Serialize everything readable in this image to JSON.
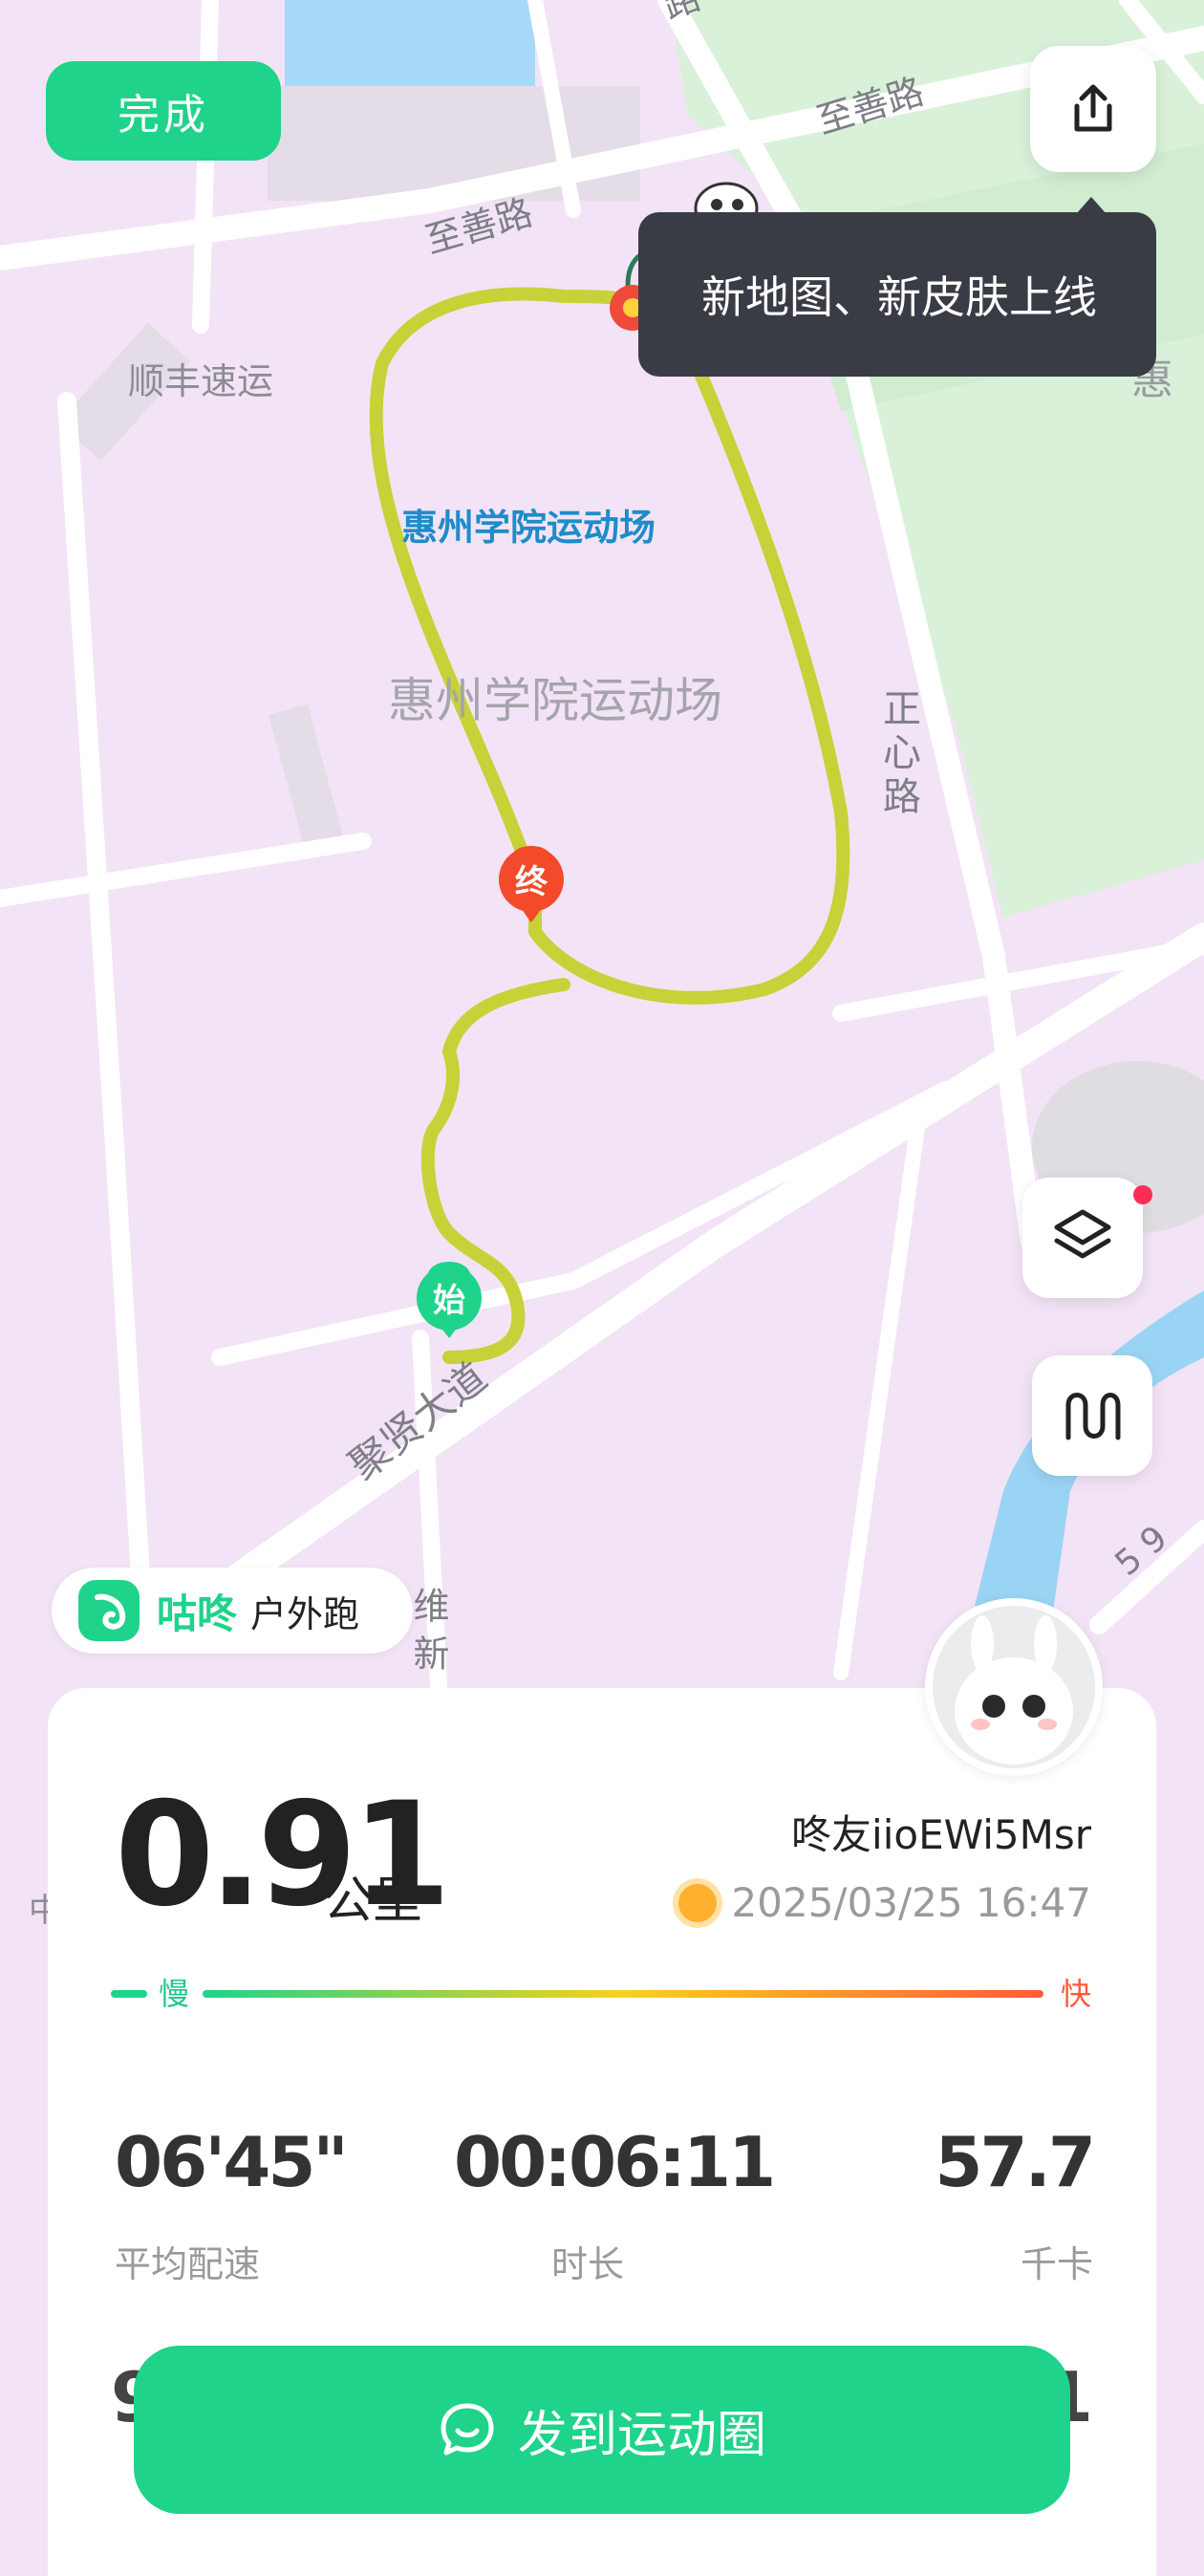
{
  "header": {
    "done_label": "完成"
  },
  "tooltip": {
    "text": "新地图、新皮肤上线"
  },
  "map": {
    "roads": {
      "zhishan_top": "至善路",
      "zhishan_mid": "至善路",
      "zhengxin": "正心路",
      "juxian": "聚贤大道",
      "weixin": "维新",
      "road_59": "5 9",
      "top_stub": "路",
      "zhong": "中"
    },
    "places": {
      "shunfeng": "顺丰速运",
      "hui_edge": "惠",
      "stadium_blue": "惠州学院运动场",
      "stadium_gray": "惠州学院运动场"
    },
    "markers": {
      "start": "始",
      "end": "终"
    }
  },
  "brand": {
    "name": "咕咚",
    "sport": "户外跑"
  },
  "summary": {
    "distance_value": "0.91",
    "distance_unit": "公里",
    "username": "咚友iioEWi5Msr",
    "datetime": "2025/03/25  16:47",
    "speed_slow_label": "慢",
    "speed_fast_label": "快"
  },
  "stats": [
    {
      "value": "06'45\"",
      "label": "平均配速"
    },
    {
      "value": "00:06:11",
      "label": "时长"
    },
    {
      "value": "57.7",
      "label": "千卡"
    }
  ],
  "partial_stats": {
    "left_value": "9",
    "right_value": "1"
  },
  "actions": {
    "post_label": "发到运动圈"
  },
  "colors": {
    "accent": "#1fd38a",
    "track": "#c6d238",
    "end_marker": "#f24a2b",
    "map_bg": "#f3e3f6",
    "park": "#d8f0d8",
    "water": "#9ad4f5"
  }
}
